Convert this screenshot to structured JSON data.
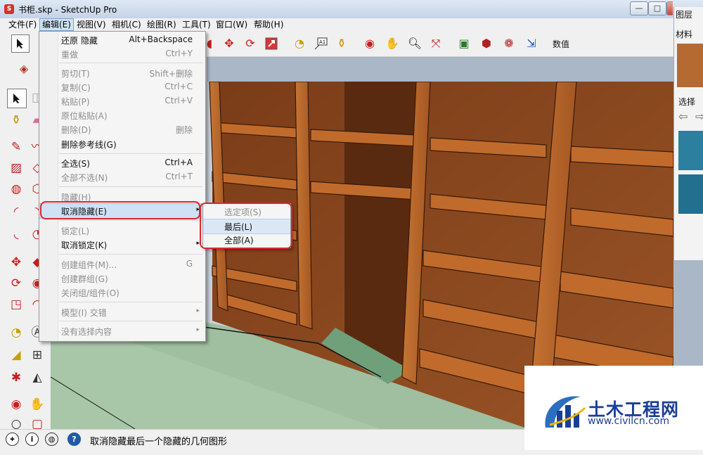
{
  "window": {
    "title": "书柜.skp - SketchUp Pro",
    "minimize_glyph": "—",
    "maximize_glyph": "□"
  },
  "menubar": [
    {
      "label": "文件(F)"
    },
    {
      "label": "编辑(E)"
    },
    {
      "label": "视图(V)"
    },
    {
      "label": "相机(C)"
    },
    {
      "label": "绘图(R)"
    },
    {
      "label": "工具(T)"
    },
    {
      "label": "窗口(W)"
    },
    {
      "label": "帮助(H)"
    }
  ],
  "toolbar": {
    "measurements_label": "数值"
  },
  "edit_menu": {
    "items": [
      {
        "label": "还原 隐藏",
        "shortcut": "Alt+Backspace",
        "enabled": true
      },
      {
        "label": "重做",
        "shortcut": "Ctrl+Y",
        "enabled": false
      },
      {
        "label": "剪切(T)",
        "shortcut": "Shift+删除",
        "enabled": false
      },
      {
        "label": "复制(C)",
        "shortcut": "Ctrl+C",
        "enabled": false
      },
      {
        "label": "粘贴(P)",
        "shortcut": "Ctrl+V",
        "enabled": false
      },
      {
        "label": "原位粘贴(A)",
        "shortcut": "",
        "enabled": false
      },
      {
        "label": "删除(D)",
        "shortcut": "删除",
        "enabled": false
      },
      {
        "label": "删除参考线(G)",
        "shortcut": "",
        "enabled": true
      },
      {
        "label": "全选(S)",
        "shortcut": "Ctrl+A",
        "enabled": true
      },
      {
        "label": "全部不选(N)",
        "shortcut": "Ctrl+T",
        "enabled": false
      },
      {
        "label": "隐藏(H)",
        "shortcut": "",
        "enabled": false
      },
      {
        "label": "取消隐藏(E)",
        "shortcut": "",
        "enabled": true,
        "submenu": true,
        "highlighted": true
      },
      {
        "label": "锁定(L)",
        "shortcut": "",
        "enabled": false
      },
      {
        "label": "取消锁定(K)",
        "shortcut": "",
        "enabled": true,
        "submenu": true
      },
      {
        "label": "创建组件(M)...",
        "shortcut": "G",
        "enabled": false
      },
      {
        "label": "创建群组(G)",
        "shortcut": "",
        "enabled": false
      },
      {
        "label": "关闭组/组件(O)",
        "shortcut": "",
        "enabled": false
      },
      {
        "label": "模型(I) 交错",
        "shortcut": "",
        "enabled": false,
        "submenu": true
      },
      {
        "label": "没有选择内容",
        "shortcut": "",
        "enabled": false,
        "submenu": true
      }
    ],
    "submenu_arrow": "▸"
  },
  "unhide_submenu": {
    "items": [
      {
        "label": "选定项(S)",
        "enabled": false
      },
      {
        "label": "最后(L)",
        "enabled": true,
        "hovered": true
      },
      {
        "label": "全部(A)",
        "enabled": true
      }
    ]
  },
  "right_panels": {
    "layers_title": "图层",
    "materials_title": "材料",
    "select_label": "选择",
    "back_glyph": "⇦",
    "forward_glyph": "⇨"
  },
  "statusbar": {
    "text": "取消隐藏最后一个隐藏的几何图形",
    "help_glyph": "?",
    "info_glyph": "i"
  },
  "watermark": {
    "title": "土木工程网",
    "url": "www.civilcn.com"
  },
  "colors": {
    "wood_front": "#b8642a",
    "wood_dark": "#5a2a10",
    "wood_inner": "#8a4a22",
    "floor": "#9fbfa0",
    "highlight_ring": "#e0262f",
    "menu_highlight": "#cfe1f5"
  }
}
